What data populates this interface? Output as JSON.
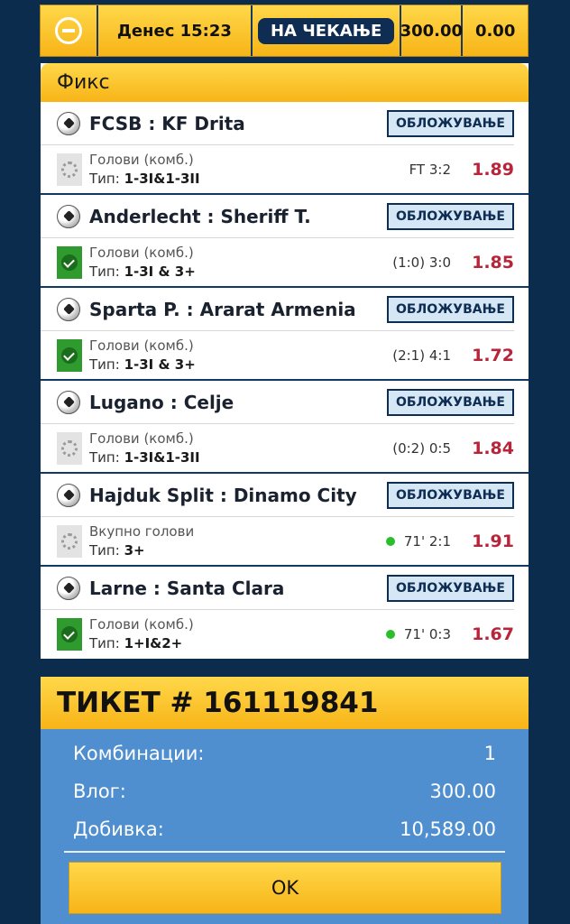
{
  "topbar": {
    "date": "Денес 15:23",
    "status": "НА ЧЕКАЊЕ",
    "stake": "300.00",
    "win": "0.00"
  },
  "panel": {
    "title": "Фикс"
  },
  "bet_label": "ОБЛОЖУВАЊЕ",
  "matches": [
    {
      "name": "FCSB : KF Drita",
      "market": "Голови (комб.)",
      "type_label": "Тип:",
      "type": "1-3I&1-3II",
      "score": "FT 3:2",
      "odd": "1.89",
      "status": "pending",
      "live": false
    },
    {
      "name": "Anderlecht : Sheriff T.",
      "market": "Голови (комб.)",
      "type_label": "Тип:",
      "type": "1-3I & 3+",
      "score": "(1:0) 3:0",
      "odd": "1.85",
      "status": "won",
      "live": false
    },
    {
      "name": "Sparta P. : Ararat Armenia",
      "market": "Голови (комб.)",
      "type_label": "Тип:",
      "type": "1-3I & 3+",
      "score": "(2:1) 4:1",
      "odd": "1.72",
      "status": "won",
      "live": false
    },
    {
      "name": "Lugano : Celje",
      "market": "Голови (комб.)",
      "type_label": "Тип:",
      "type": "1-3I&1-3II",
      "score": "(0:2) 0:5",
      "odd": "1.84",
      "status": "pending",
      "live": false
    },
    {
      "name": "Hajduk Split : Dinamo City",
      "market": "Вкупно голови",
      "type_label": "Тип:",
      "type": "3+",
      "score": "71' 2:1",
      "odd": "1.91",
      "status": "pending",
      "live": true
    },
    {
      "name": "Larne : Santa Clara",
      "market": "Голови (комб.)",
      "type_label": "Тип:",
      "type": "1+I&2+",
      "score": "71' 0:3",
      "odd": "1.67",
      "status": "won",
      "live": true
    }
  ],
  "ticket": {
    "title": "ТИКЕТ # 161119841",
    "combinations_label": "Комбинации:",
    "combinations": "1",
    "stake_label": "Влог:",
    "stake": "300.00",
    "win_label": "Добивка:",
    "win": "10,589.00",
    "ok_label": "OK"
  },
  "colors": {
    "accent": "#f7b417",
    "navy": "#0f2d52",
    "odd": "#b8243a",
    "ticket_bg": "#4f8fd0"
  }
}
